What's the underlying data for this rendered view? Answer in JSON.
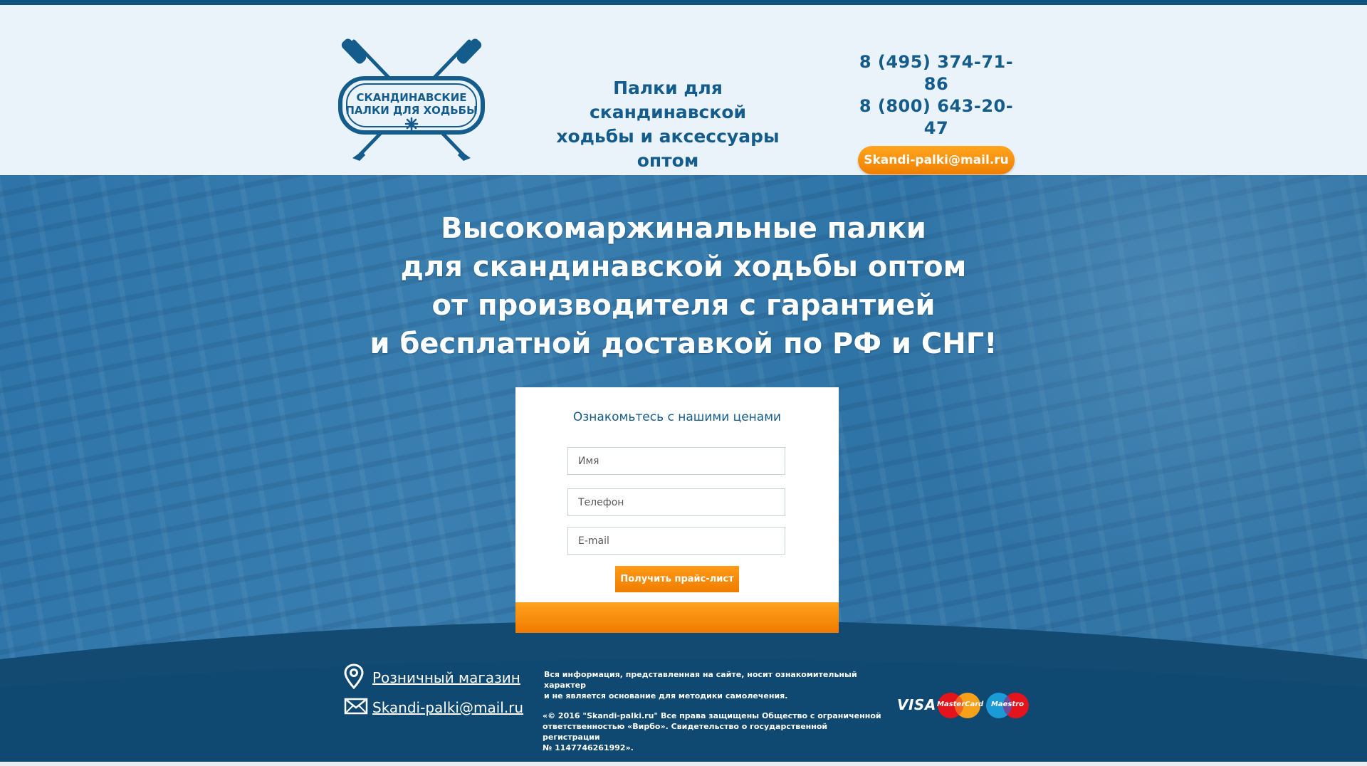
{
  "header": {
    "logo_text_line1": "СКАНДИНАВСКИЕ",
    "logo_text_line2": "ПАЛКИ ДЛЯ ХОДЬБЫ",
    "tagline_line1": "Палки для скандинавской",
    "tagline_line2": "ходьбы и аксессуары оптом",
    "phone1": "8 (495) 374-71-86",
    "phone2": "8 (800) 643-20-47",
    "email_button": "Skandi-palki@mail.ru"
  },
  "hero": {
    "title_line1": "Высокомаржинальные палки",
    "title_line2": "для скандинавской ходьбы оптом",
    "title_line3": "от производителя с гарантией",
    "title_line4": "и бесплатной доставкой по РФ и СНГ!"
  },
  "form": {
    "title": "Ознакомьтесь с нашими ценами",
    "name_placeholder": "Имя",
    "phone_placeholder": "Телефон",
    "email_placeholder": "E-mail",
    "submit_label": "Получить прайс-лист"
  },
  "footer": {
    "store_link": "Розничный магазин",
    "email_link": "Skandi-palki@mail.ru",
    "disclaimer_line1": "Вся информация, представленная на сайте, носит ознакомительный характер",
    "disclaimer_line2": "и не является основание для методики самолечения.",
    "copyright_line1": "«© 2016 \"Skandi-palki.ru\" Все права защищены Общество с ограниченной",
    "copyright_line2": "ответственностью «Вирбо». Свидетельство о государственной регистрации",
    "copyright_line3": "№ 1147746261992».",
    "payment_visa": "VISA",
    "payment_mastercard": "MasterCard",
    "payment_maestro": "Maestro"
  },
  "icons": {
    "logo": "crossed-poles-logo",
    "location": "map-pin-icon",
    "mail": "envelope-icon"
  },
  "colors": {
    "brand_blue": "#145c8c",
    "accent_orange": "#f58a0a",
    "footer_navy": "#0f4a72"
  }
}
